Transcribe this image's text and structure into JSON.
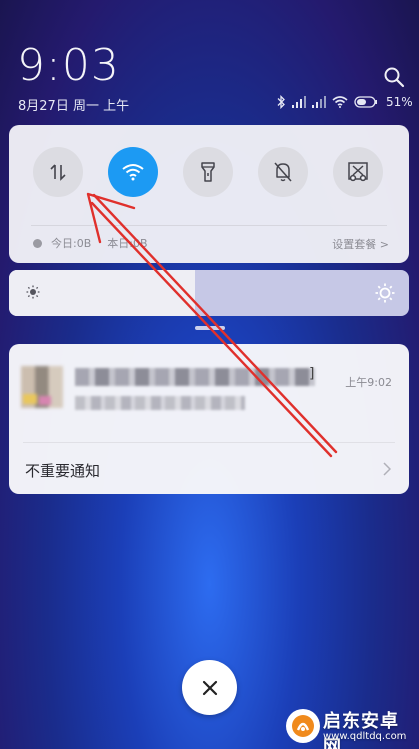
{
  "status": {
    "time": "9:03",
    "date": "8月27日 周一 上午",
    "battery": "51%",
    "icons": [
      "bluetooth-icon",
      "signal-icon",
      "signal-icon",
      "wifi-icon",
      "battery-icon"
    ]
  },
  "quick_settings": {
    "toggles": [
      {
        "name": "mobile-data",
        "icon": "data-transfer-icon",
        "active": false
      },
      {
        "name": "wifi",
        "icon": "wifi-icon",
        "active": true
      },
      {
        "name": "flashlight",
        "icon": "flashlight-icon",
        "active": false
      },
      {
        "name": "mute",
        "icon": "bell-off-icon",
        "active": false
      },
      {
        "name": "screenshot",
        "icon": "scissors-icon",
        "active": false
      }
    ],
    "data_usage": "今日:0B",
    "data_usage_hidden": "本日:0B",
    "settings_label": "设置套餐 >"
  },
  "brightness": {
    "level": 0.465
  },
  "notification": {
    "title_end": "]",
    "time": "上午9:02",
    "unimportant_label": "不重要通知"
  },
  "watermark": {
    "brand": "启东安卓网",
    "url": "www.qdltdq.com"
  },
  "colors": {
    "accent": "#1c9af3",
    "annotation": "#e0302c"
  }
}
